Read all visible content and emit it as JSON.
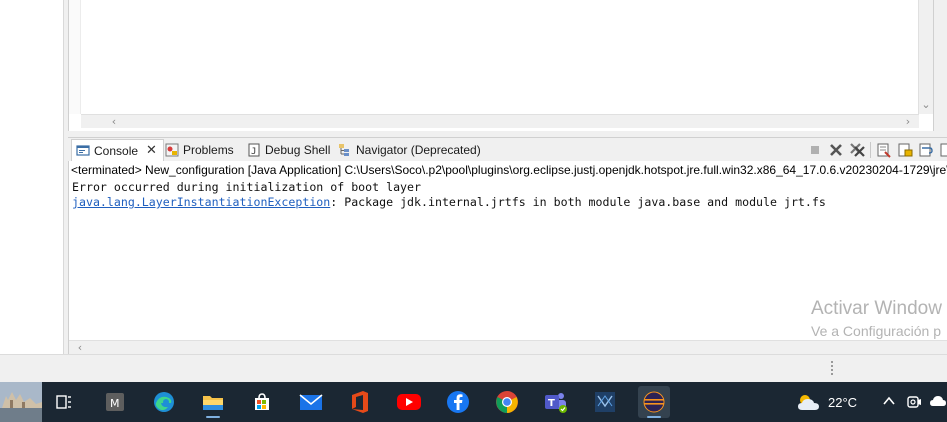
{
  "console_view": {
    "tabs": [
      {
        "label": "Console",
        "active": true,
        "icon": "console-icon"
      },
      {
        "label": "Problems",
        "active": false,
        "icon": "problems-icon"
      },
      {
        "label": "Debug Shell",
        "active": false,
        "icon": "debug-shell-icon"
      },
      {
        "label": "Navigator (Deprecated)",
        "active": false,
        "icon": "navigator-icon"
      }
    ],
    "close_symbol": "✕",
    "description": "<terminated> New_configuration [Java Application] C:\\Users\\Soco\\.p2\\pool\\plugins\\org.eclipse.justj.openjdk.hotspot.jre.full.win32.x86_64_17.0.6.v20230204-1729\\jre\\",
    "output": {
      "line1": "Error occurred during initialization of boot layer",
      "exception_link": "java.lang.LayerInstantiationException",
      "line2_rest": ": Package jdk.internal.jrtfs in both module java.base and module jrt.fs"
    },
    "toolbar": [
      "terminate-icon",
      "remove-launch-icon",
      "remove-all-terminated-icon",
      "clear-console-icon",
      "scroll-lock-icon",
      "word-wrap-icon",
      "pin-console-icon"
    ]
  },
  "watermark": {
    "title": "Activar Window",
    "subtitle": "Ve a Configuración p"
  },
  "taskbar": {
    "apps": [
      "task-view-icon",
      "m-app-icon",
      "edge-icon",
      "file-explorer-icon",
      "microsoft-store-icon",
      "mail-icon",
      "office-icon",
      "youtube-icon",
      "facebook-icon",
      "chrome-icon",
      "teams-icon",
      "network-app-icon",
      "eclipse-icon"
    ],
    "weather": {
      "temperature": "22°C",
      "icon": "cloudy-sun-icon"
    },
    "tray": [
      "chevron-up-icon",
      "camera-icon",
      "cloud-icon"
    ]
  }
}
